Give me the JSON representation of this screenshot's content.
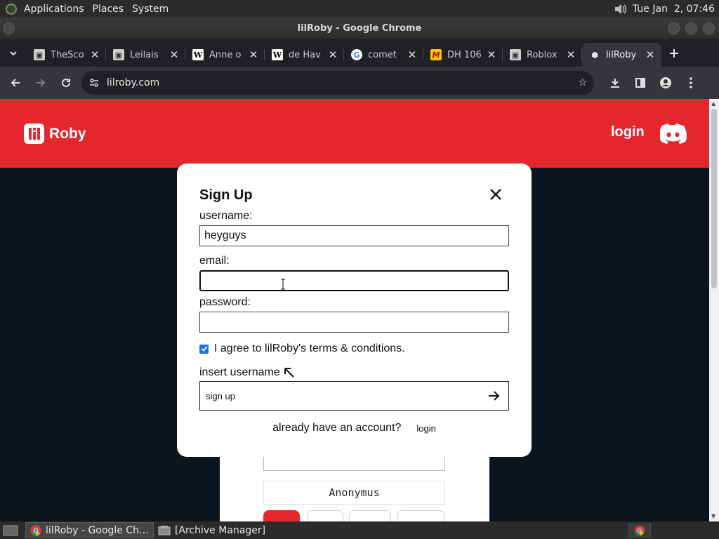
{
  "top_panel": {
    "menus": [
      "Applications",
      "Places",
      "System"
    ],
    "clock": "Tue Jan  2, 07:46"
  },
  "window": {
    "title": "lilRoby - Google Chrome"
  },
  "tabs": [
    {
      "label": "TheSco",
      "favicon": "roblox-icon"
    },
    {
      "label": "Leilais",
      "favicon": "roblox-icon"
    },
    {
      "label": "Anne o",
      "favicon": "wikipedia-icon"
    },
    {
      "label": "de Hav",
      "favicon": "wikipedia-icon"
    },
    {
      "label": "comet",
      "favicon": "google-icon"
    },
    {
      "label": "DH 106",
      "favicon": "m-icon"
    },
    {
      "label": "Roblox",
      "favicon": "roblox-icon"
    },
    {
      "label": "lilRoby",
      "favicon": "lilroby-icon",
      "active": true
    }
  ],
  "toolbar": {
    "url": "lilroby.com"
  },
  "site_header": {
    "brand": "Roby",
    "login_label": "login"
  },
  "modal": {
    "title": "Sign Up",
    "username_label": "username:",
    "username_value": "heyguys",
    "email_label": "email:",
    "email_value": "",
    "password_label": "password:",
    "password_value": "",
    "agree_label": "I agree to lilRoby's terms & conditions.",
    "agree_checked": true,
    "hint": "insert username",
    "signup_label": "sign up",
    "footer_text": "already have an account?",
    "footer_login": "login"
  },
  "background_card": {
    "name": "Anonymus"
  },
  "taskbar": {
    "items": [
      {
        "label": "lilRoby - Google Ch…",
        "active": true
      },
      {
        "label": "[Archive Manager]",
        "active": false
      }
    ]
  },
  "colors": {
    "brand_red": "#e3272d",
    "page_bg": "#0b151e",
    "checkbox_blue": "#1a73e8"
  }
}
